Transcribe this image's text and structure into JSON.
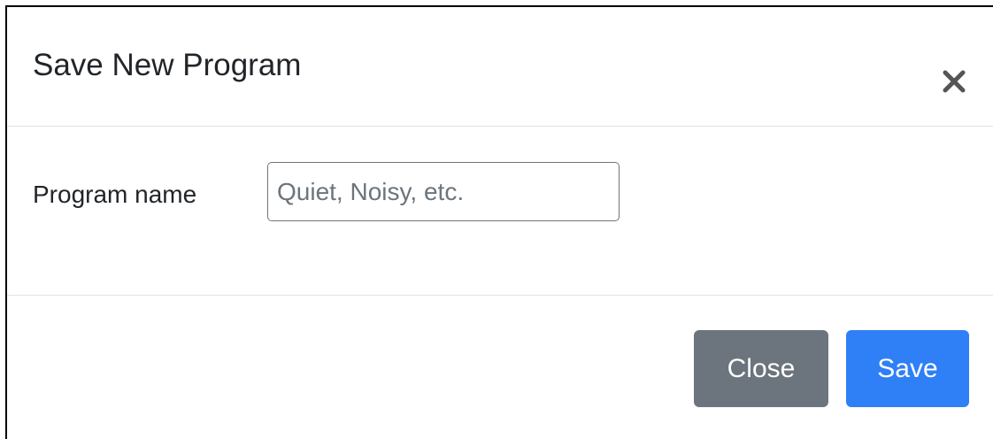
{
  "dialog": {
    "title": "Save New Program",
    "close_icon": "close-icon"
  },
  "form": {
    "program_name_label": "Program name",
    "program_name_value": "",
    "program_name_placeholder": "Quiet, Noisy, etc."
  },
  "footer": {
    "close_label": "Close",
    "save_label": "Save"
  },
  "colors": {
    "secondary_button": "#6c757d",
    "primary_button": "#2f7ff6",
    "divider": "#dee2e6",
    "text": "#212529"
  }
}
